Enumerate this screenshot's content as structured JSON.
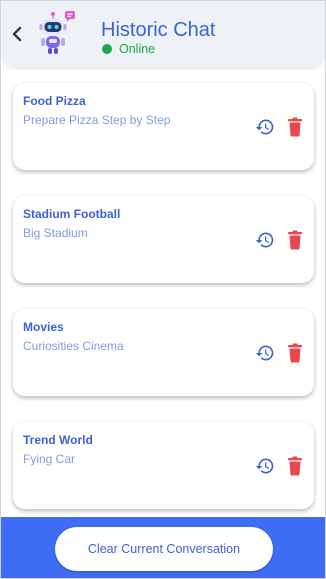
{
  "header": {
    "title": "Historic Chat",
    "status": "Online",
    "status_color": "#1aa84a",
    "back_icon": "chevron-left-icon",
    "avatar_icon": "robot-avatar-icon"
  },
  "conversations": [
    {
      "title": "Food Pizza",
      "subtitle": "Prepare Pizza Step by Step",
      "history_icon": "history-icon",
      "delete_icon": "trash-icon"
    },
    {
      "title": "Stadium Football",
      "subtitle": "Big Stadium",
      "history_icon": "history-icon",
      "delete_icon": "trash-icon"
    },
    {
      "title": "Movies",
      "subtitle": "Curiosities Cinema",
      "history_icon": "history-icon",
      "delete_icon": "trash-icon"
    },
    {
      "title": "Trend World",
      "subtitle": "Fying Car",
      "history_icon": "history-icon",
      "delete_icon": "trash-icon"
    }
  ],
  "footer": {
    "clear_label": "Clear Current Conversation"
  },
  "colors": {
    "accent": "#3a63d6",
    "footer_bg": "#3e6cf5",
    "delete": "#e8474f",
    "subtitle": "#7f9be0"
  }
}
